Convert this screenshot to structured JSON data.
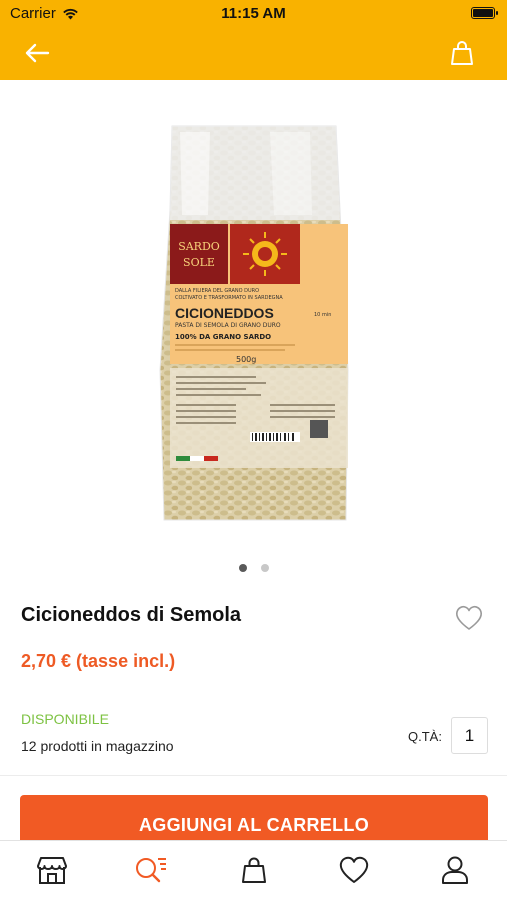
{
  "status_bar": {
    "carrier": "Carrier",
    "time": "11:15 AM"
  },
  "header": {
    "back_icon": "arrow-left-icon",
    "cart_icon": "shopping-bag-icon"
  },
  "product_image": {
    "brand_line1": "SARDO",
    "brand_line2": "SOLE",
    "tagline1": "DALLA FILIERA DEL GRANO DURO",
    "tagline2": "COLTIVATO E TRASFORMATO IN SARDEGNA",
    "product_name": "CICIONEDDOS",
    "cook_time": "10 min",
    "subtitle": "PASTA DI SEMOLA DI GRANO DURO",
    "claim": "100% DA GRANO SARDO",
    "weight": "500g"
  },
  "carousel": {
    "page_count": 2,
    "active_index": 0
  },
  "product": {
    "title": "Cicioneddos di Semola",
    "price": "2,70 €",
    "tax_note": "(tasse incl.)",
    "availability": "DISPONIBILE",
    "stock": "12 prodotti in magazzino",
    "qty_label": "Q.TÀ:",
    "qty_value": "1"
  },
  "actions": {
    "add_to_cart": "AGGIUNGI AL CARRELLO"
  },
  "tab_bar": {
    "items": [
      {
        "icon": "store-icon"
      },
      {
        "icon": "search-list-icon",
        "active": true
      },
      {
        "icon": "shopping-bag-icon"
      },
      {
        "icon": "heart-icon"
      },
      {
        "icon": "user-icon"
      }
    ]
  },
  "colors": {
    "header": "#F9B200",
    "accent": "#F15A24",
    "price": "#EE5A24",
    "available": "#7DC242"
  }
}
